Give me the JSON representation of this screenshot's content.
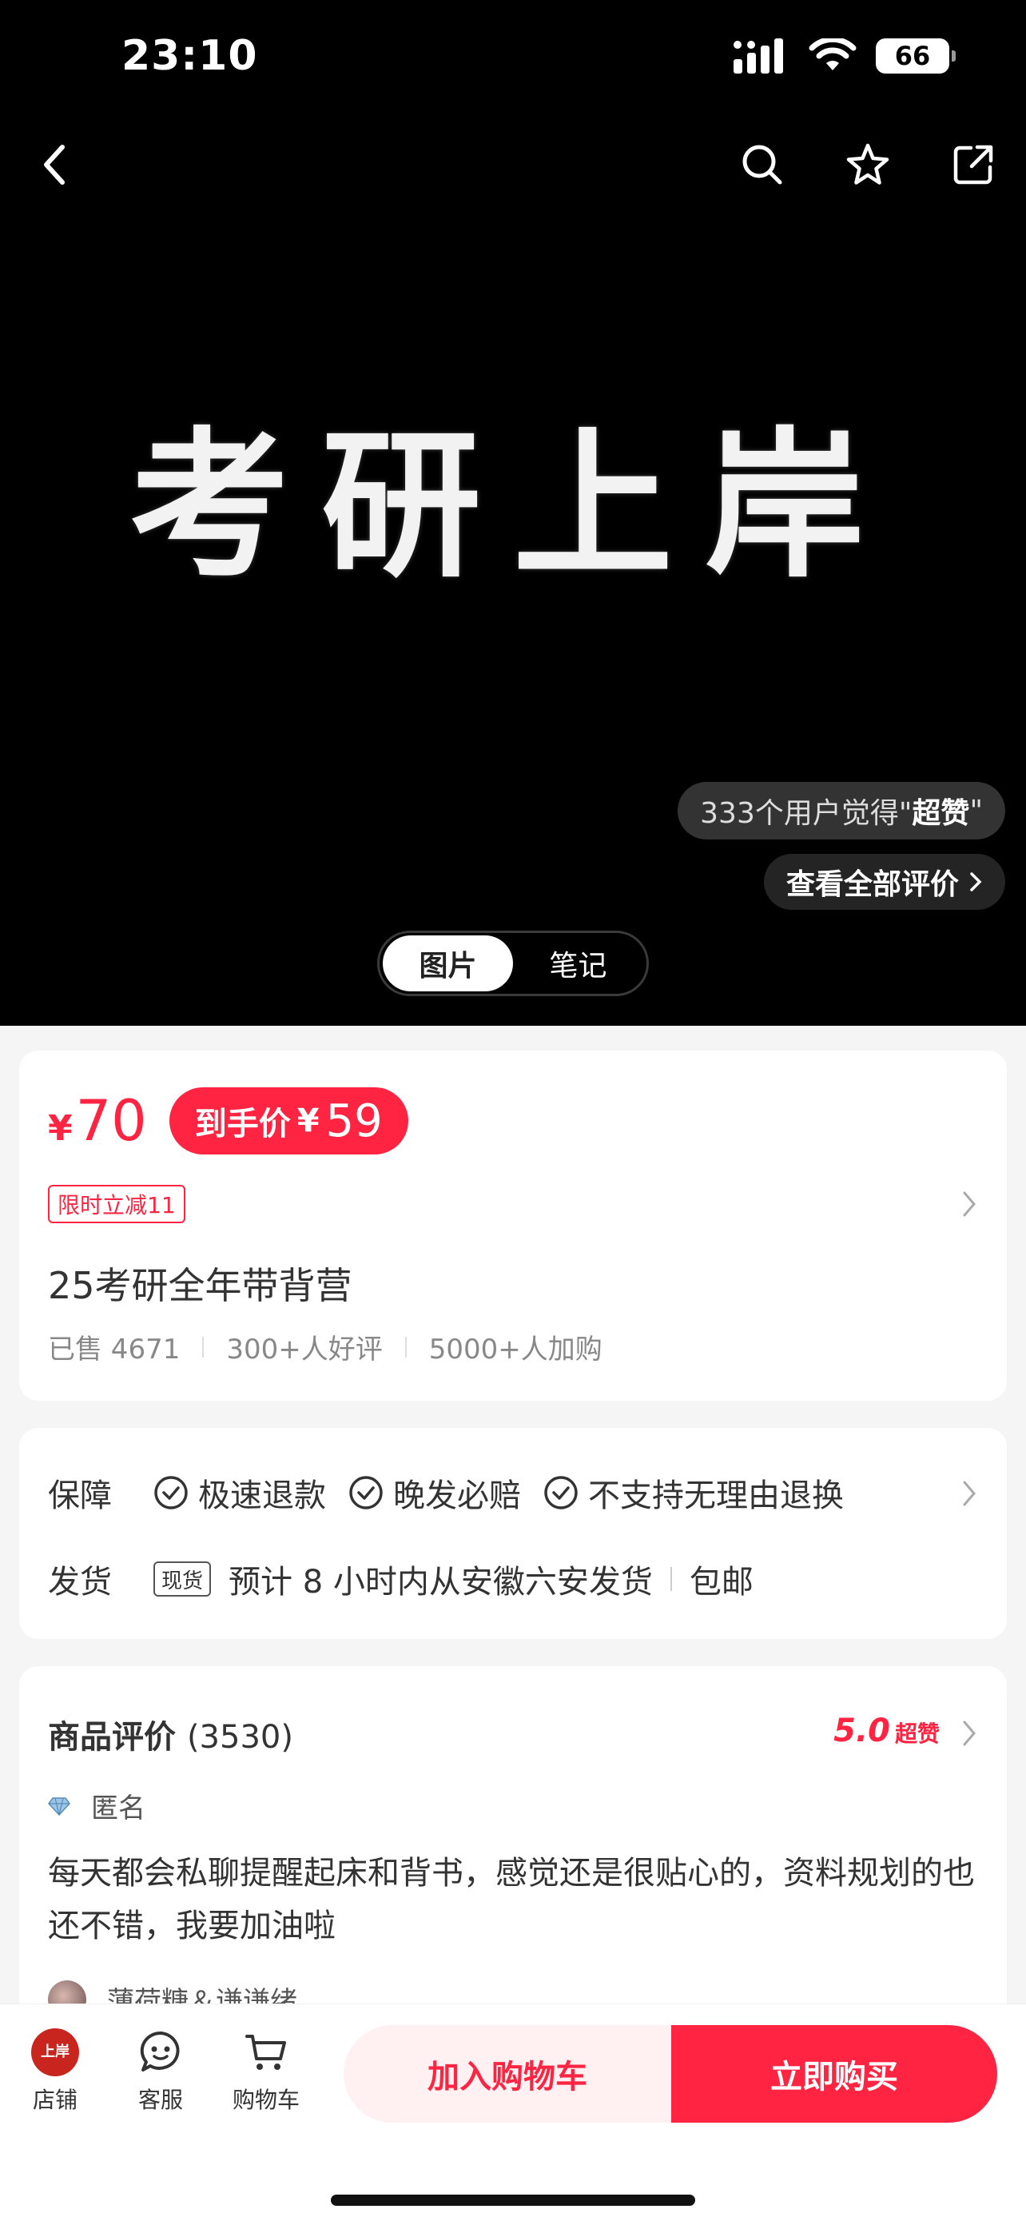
{
  "status_bar": {
    "time": "23:10",
    "battery": "66"
  },
  "hero": {
    "title": "考研上岸",
    "liked_badge_prefix": "333个用户觉得\"",
    "liked_badge_emph": "超赞",
    "liked_badge_suffix": "\"",
    "view_all_reviews": "查看全部评价",
    "toggle": [
      "图片",
      "笔记"
    ]
  },
  "price": {
    "currency": "¥",
    "current": "70",
    "final_label": "到手价",
    "final_currency": "¥",
    "final_value": "59",
    "promo_tag": "限时立减11"
  },
  "product": {
    "title": "25考研全年带背营",
    "sold": "已售 4671",
    "good_reviews": "300+人好评",
    "added_to_cart": "5000+人加购"
  },
  "guarantee": {
    "label": "保障",
    "items": [
      "极速退款",
      "晚发必赔",
      "不支持无理由退换"
    ],
    "shipping_label": "发货",
    "stock_badge": "现货",
    "shipping_text": "预计 8 小时内从安徽六安发货",
    "free_shipping": "包邮"
  },
  "reviews": {
    "title": "商品评价",
    "count": "(3530)",
    "score": "5.0",
    "score_label": "超赞",
    "first_reviewer": "匿名",
    "first_review": "每天都会私聊提醒起床和背书，感觉还是很贴心的，资料规划的也还不错，我要加油啦",
    "second_reviewer": "薄荷糖＆谦谦绪"
  },
  "bottom_bar": {
    "store": "店铺",
    "store_logo": "上岸",
    "service": "客服",
    "cart": "购物车",
    "add_to_cart": "加入购物车",
    "buy_now": "立即购买"
  },
  "colors": {
    "accent": "#ff2442",
    "hero_bg": "#000000"
  }
}
